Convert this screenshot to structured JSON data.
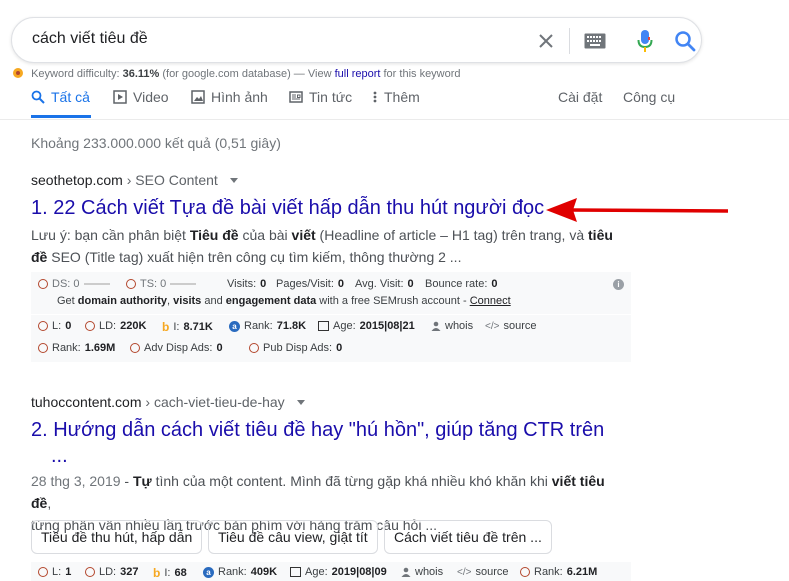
{
  "search": {
    "query": "cách viết tiêu đề"
  },
  "keyword_difficulty": {
    "label": "Keyword difficulty:",
    "value": "36.11%",
    "source": "(for google.com database) — View",
    "link": "full report",
    "suffix": "for this keyword"
  },
  "tabs": [
    {
      "label": "Tất cả",
      "icon": "search-icon",
      "active": true
    },
    {
      "label": "Video",
      "icon": "play-icon"
    },
    {
      "label": "Hình ảnh",
      "icon": "image-icon"
    },
    {
      "label": "Tin tức",
      "icon": "news-icon"
    },
    {
      "label": "Thêm",
      "icon": "more-vert-icon"
    }
  ],
  "tools": {
    "settings": "Cài đặt",
    "tools": "Công cụ"
  },
  "result_stats": "Khoảng 233.000.000 kết quả (0,51 giây)",
  "results": [
    {
      "domain": "seothetop.com",
      "crumb": "› SEO Content",
      "title": "1. 22 Cách viết Tựa đề bài viết hấp dẫn thu hút người đọc",
      "snippet_line1_a": "Lưu ý: bạn cần phân biệt ",
      "snippet_line1_b": "Tiêu đề",
      "snippet_line1_c": " của bài ",
      "snippet_line1_d": "viết",
      "snippet_line1_e": " (Headline of article – H1 tag) trên trang, và ",
      "snippet_line1_f": "tiêu",
      "snippet_line2_a": "đề",
      "snippet_line2_b": " SEO (Title tag) xuất hiện trên công cụ tìm kiếm, thông thường 2 ...",
      "semrush": {
        "ds": "DS: 0",
        "ts": "TS: 0",
        "visits": "Visits:",
        "visits_val": "0",
        "pages_visit": "Pages/Visit:",
        "pages_visit_val": "0",
        "avg_visit": "Avg. Visit:",
        "avg_visit_val": "0",
        "bounce": "Bounce rate:",
        "bounce_val": "0",
        "promo_a": "Get ",
        "promo_b": "domain authority",
        "promo_c": ", ",
        "promo_d": "visits",
        "promo_e": " and ",
        "promo_f": "engagement data",
        "promo_g": " with a free SEMrush account - ",
        "promo_link": "Connect",
        "l": "L:",
        "l_val": "0",
        "ld": "LD:",
        "ld_val": "220K",
        "i": "I:",
        "i_val": "8.71K",
        "rank": "Rank:",
        "rank_val": "71.8K",
        "age": "Age:",
        "age_val": "2015|08|21",
        "whois": "whois",
        "source": "source",
        "rank2": "Rank:",
        "rank2_val": "1.69M",
        "adv": "Adv Disp Ads:",
        "adv_val": "0",
        "pub": "Pub Disp Ads:",
        "pub_val": "0"
      }
    },
    {
      "domain": "tuhoccontent.com",
      "crumb": "› cach-viet-tieu-de-hay",
      "title_line1": "2. Hướng dẫn cách viết tiêu đề hay \"hú hồn\", giúp tăng CTR trên",
      "title_line2": "...",
      "snippet_line1_date": "28 thg 3, 2019",
      "snippet_line1_sep": " - ",
      "snippet_line1_b": "Tự",
      "snippet_line1_c": " tình của một content. Mình đã từng gặp khá nhiều khó khăn khi ",
      "snippet_line1_d": "viết tiêu đề",
      "snippet_line1_e": ",",
      "snippet_line2": "từng phân vân nhiều lần trước bàn phím với hàng trăm câu hỏi ...",
      "chips": [
        "Tiêu đề thu hút, hấp dẫn",
        "Tiêu đề câu view, giật tít",
        "Cách viết tiêu đề trên ..."
      ],
      "semrush": {
        "l": "L:",
        "l_val": "1",
        "ld": "LD:",
        "ld_val": "327",
        "i": "I:",
        "i_val": "68",
        "rank": "Rank:",
        "rank_val": "409K",
        "age": "Age:",
        "age_val": "2019|08|09",
        "whois": "whois",
        "source": "source",
        "rank2": "Rank:",
        "rank2_val": "6.21M"
      }
    }
  ],
  "colors": {
    "link": "#1a0dab",
    "accent": "#1a73e8",
    "arrow": "#e00000"
  }
}
